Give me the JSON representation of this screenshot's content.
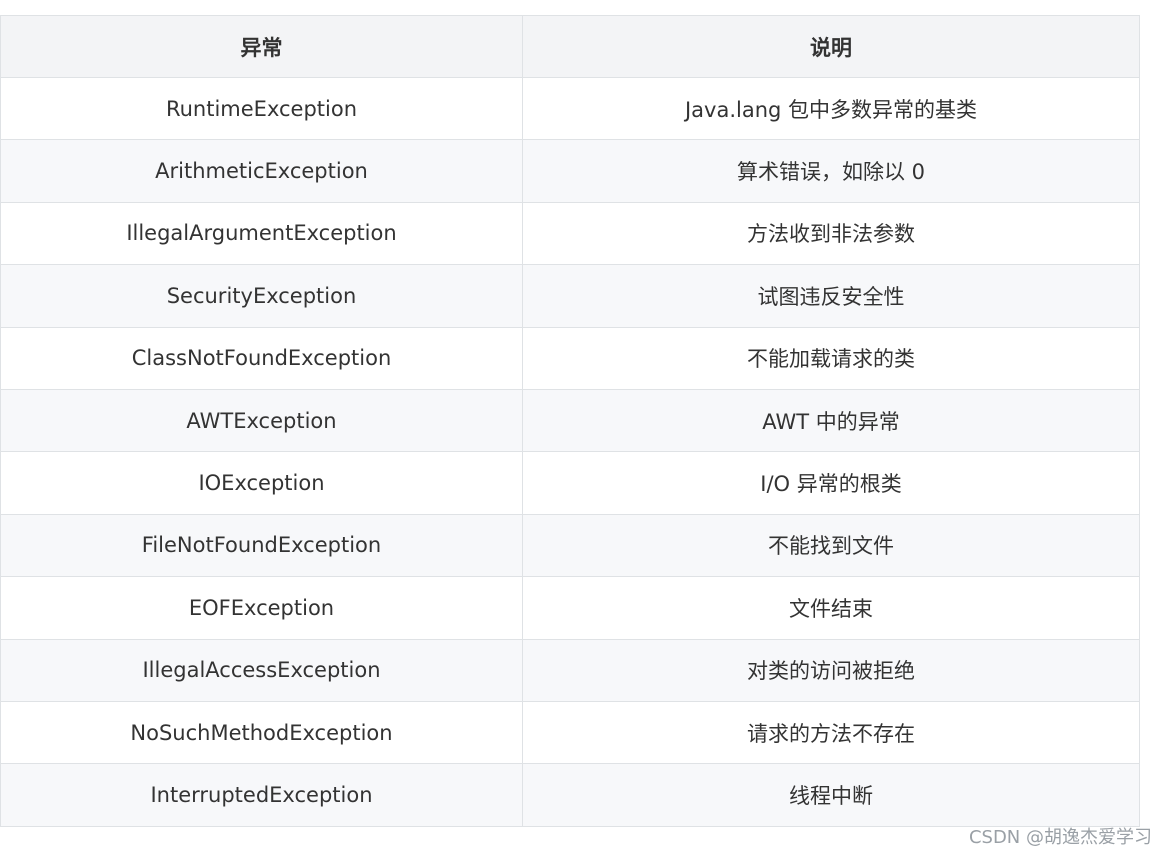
{
  "table": {
    "headers": [
      "异常",
      "说明"
    ],
    "rows": [
      [
        "RuntimeException",
        "Java.lang 包中多数异常的基类"
      ],
      [
        "ArithmeticException",
        "算术错误，如除以 0"
      ],
      [
        "IllegalArgumentException",
        "方法收到非法参数"
      ],
      [
        "SecurityException",
        "试图违反安全性"
      ],
      [
        "ClassNotFoundException",
        "不能加载请求的类"
      ],
      [
        "AWTException",
        "AWT 中的异常"
      ],
      [
        "IOException",
        "I/O 异常的根类"
      ],
      [
        "FileNotFoundException",
        "不能找到文件"
      ],
      [
        "EOFException",
        "文件结束"
      ],
      [
        "IllegalAccessException",
        "对类的访问被拒绝"
      ],
      [
        "NoSuchMethodException",
        "请求的方法不存在"
      ],
      [
        "InterruptedException",
        "线程中断"
      ]
    ]
  },
  "watermark": "CSDN @胡逸杰爱学习"
}
